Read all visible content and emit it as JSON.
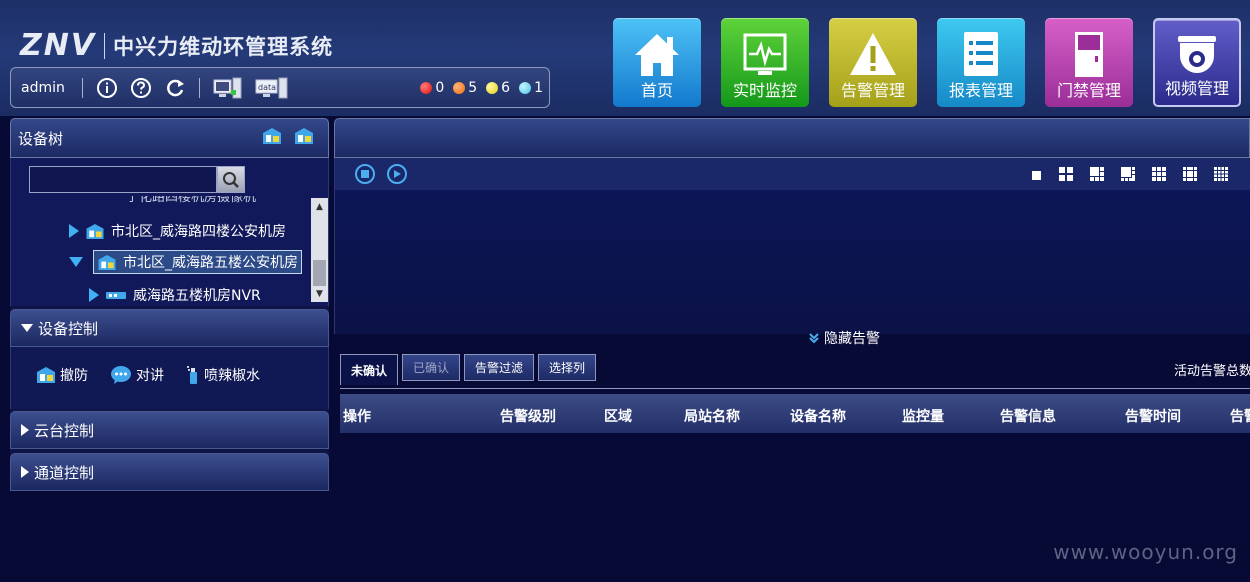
{
  "header": {
    "logo": "ZNV",
    "title": "中兴力维动环管理系统"
  },
  "userbar": {
    "username": "admin",
    "icons": [
      "info-icon",
      "help-icon",
      "refresh-icon",
      "monitor-alarm-icon",
      "data-server-icon"
    ],
    "stats": [
      {
        "value": "0",
        "color": "#e0201b"
      },
      {
        "value": "5",
        "color": "#f07b1c"
      },
      {
        "value": "6",
        "color": "#f2e02c"
      },
      {
        "value": "1",
        "color": "#6fd3ea"
      }
    ]
  },
  "nav": [
    {
      "label": "首页",
      "icon": "home-icon"
    },
    {
      "label": "实时监控",
      "icon": "monitor-icon"
    },
    {
      "label": "告警管理",
      "icon": "warning-icon"
    },
    {
      "label": "报表管理",
      "icon": "report-icon"
    },
    {
      "label": "门禁管理",
      "icon": "door-icon"
    },
    {
      "label": "视频管理",
      "icon": "camera-icon"
    }
  ],
  "device_tree": {
    "title": "设备树",
    "search_value": "",
    "clipped_row": "宁化路四楼机房摄像机",
    "rows": [
      {
        "label": "市北区_威海路四楼公安机房"
      },
      {
        "label": "市北区_威海路五楼公安机房"
      },
      {
        "label": "威海路五楼机房NVR"
      }
    ]
  },
  "device_control": {
    "title": "设备控制",
    "items": [
      {
        "label": "撤防",
        "icon": "disarm-icon"
      },
      {
        "label": "对讲",
        "icon": "intercom-icon"
      },
      {
        "label": "喷辣椒水",
        "icon": "spray-icon"
      }
    ]
  },
  "ptz_control": {
    "title": "云台控制"
  },
  "channel_control": {
    "title": "通道控制"
  },
  "alarm_panel": {
    "hide_label": "隐藏告警",
    "tabs": [
      "未确认",
      "已确认",
      "告警过滤",
      "选择列"
    ],
    "total_label": "活动告警总数",
    "columns": [
      "操作",
      "告警级别",
      "区域",
      "局站名称",
      "设备名称",
      "监控量",
      "告警信息",
      "告警时间",
      "告警"
    ]
  },
  "watermark": "www.wooyun.org"
}
